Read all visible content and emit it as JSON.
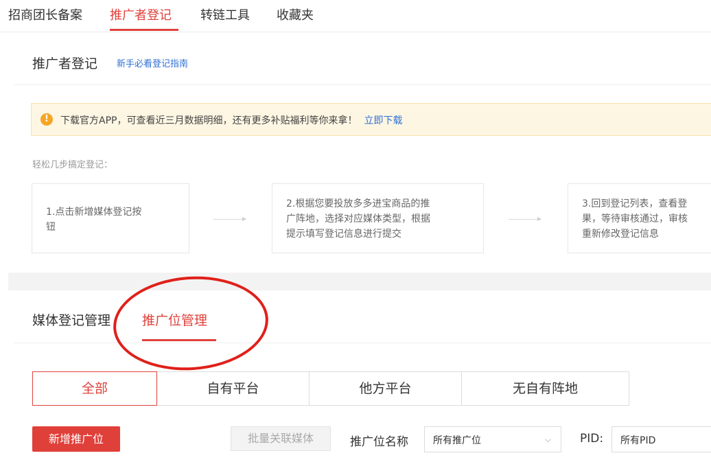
{
  "top_nav": {
    "tabs": [
      {
        "label": "招商团长备案",
        "active": false
      },
      {
        "label": "推广者登记",
        "active": true
      },
      {
        "label": "转链工具",
        "active": false
      },
      {
        "label": "收藏夹",
        "active": false
      }
    ]
  },
  "header": {
    "title": "推广者登记",
    "guide_link": "新手必看登记指南"
  },
  "notice": {
    "icon": "alert-icon",
    "icon_glyph": "!",
    "text": "下载官方APP，可查看近三月数据明细，还有更多补贴福利等你来拿！",
    "link": "立即下载"
  },
  "steps": {
    "intro": "轻松几步搞定登记：",
    "items": [
      {
        "lines": [
          "1.点击新增媒体登记按",
          "钮"
        ]
      },
      {
        "lines": [
          "2.根据您要投放多多进宝商品的推",
          "广阵地，选择对应媒体类型，根据",
          "提示填写登记信息进行提交"
        ]
      },
      {
        "lines": [
          "3.回到登记列表，查看登",
          "果，等待审核通过，审核",
          "重新修改登记信息"
        ]
      }
    ]
  },
  "sub_tabs": {
    "items": [
      {
        "label": "媒体登记管理",
        "active": false
      },
      {
        "label": "推广位管理",
        "active": true
      }
    ]
  },
  "segments": {
    "items": [
      {
        "label": "全部",
        "active": true
      },
      {
        "label": "自有平台",
        "active": false
      },
      {
        "label": "他方平台",
        "active": false
      },
      {
        "label": "无自有阵地",
        "active": false
      }
    ]
  },
  "toolbar": {
    "new_button": "新增推广位",
    "batch_button": "批量关联媒体",
    "position_label": "推广位名称",
    "position_select": "所有推广位",
    "pid_label": "PID:",
    "pid_select": "所有PID"
  },
  "colors": {
    "accent": "#e0403a",
    "link": "#2f6fd6",
    "annotation": "#e0201a"
  }
}
